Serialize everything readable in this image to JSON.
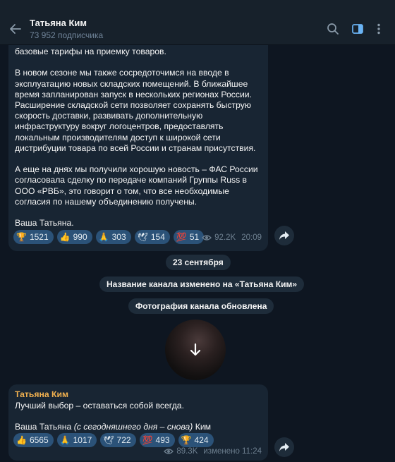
{
  "header": {
    "title": "Татьяна Ким",
    "subtitle": "73 952 подписчика"
  },
  "msg1": {
    "paragraphs": [
      "базовые тарифы на приемку товаров.",
      "В новом сезоне мы также сосредоточимся на вводе в эксплуатацию новых складских помещений. В ближайшее время запланирован запуск в нескольких регионах России. Расширение складской сети позволяет сохранять быструю скорость доставки, развивать дополнительную инфраструктуру вокруг логоцентров, предоставлять локальным производителям доступ к широкой сети дистрибуции товара по всей России и странам присутствия.",
      "А еще на днях мы получили хорошую новость – ФАС России согласовала сделку по передаче компаний Группы Russ в ООО «РВБ», это говорит о том, что все необходимые согласия по нашему объединению получены.",
      "Ваша Татьяна."
    ],
    "reactions": [
      {
        "emoji": "🏆",
        "count": "1521"
      },
      {
        "emoji": "👍",
        "count": "990"
      },
      {
        "emoji": "🙏",
        "count": "303"
      },
      {
        "emoji": "🕊",
        "count": "154"
      },
      {
        "emoji": "💯",
        "count": "51"
      }
    ],
    "views": "92.2K",
    "time": "20:09"
  },
  "service": {
    "date": "23 сентября",
    "rename": "Название канала изменено на «Татьяна Ким»",
    "photo_updated": "Фотография канала обновлена"
  },
  "msg2": {
    "author": "Татьяна Ким",
    "line1": "Лучший выбор – оставаться собой всегда.",
    "line2_start": "Ваша Татьяна ",
    "line2_italic": "(с сегодняшнего дня – снова)",
    "line2_end": " Ким",
    "reactions": [
      {
        "emoji": "👍",
        "count": "6565"
      },
      {
        "emoji": "🙏",
        "count": "1017"
      },
      {
        "emoji": "🕊",
        "count": "722"
      },
      {
        "emoji": "💯",
        "count": "493"
      },
      {
        "emoji": "🏆",
        "count": "424"
      }
    ],
    "views": "89.3K",
    "time": "изменено 11:24"
  },
  "colors": {
    "background": "#0e1621",
    "header": "#17212b",
    "bubble": "#182533",
    "reaction": "#2b5278",
    "author": "#f0b04f",
    "muted": "#708499"
  },
  "icons": {
    "back": "arrow-left-icon",
    "search": "search-icon",
    "sidebar": "sidebar-toggle-icon",
    "menu": "more-vertical-icon",
    "share": "share-icon",
    "views": "eye-icon",
    "download": "download-icon"
  }
}
